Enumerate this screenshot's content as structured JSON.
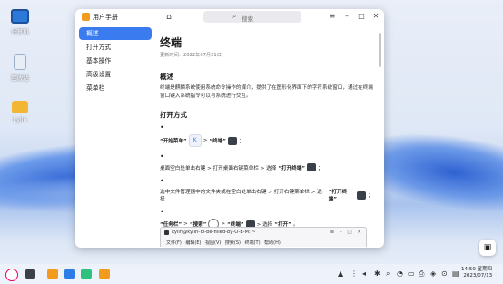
{
  "desktop": {
    "icons": [
      {
        "label": "计算机",
        "icon": "computer-icon"
      },
      {
        "label": "回收站",
        "icon": "trash-icon"
      },
      {
        "label": "kylin",
        "icon": "folder-icon"
      }
    ]
  },
  "window": {
    "app_title": "用户手册",
    "search_placeholder": "搜索",
    "controls": {
      "menu": "≡",
      "minimize": "–",
      "maximize": "□",
      "close": "✕"
    }
  },
  "sidebar": {
    "items": [
      {
        "label": "概述",
        "active": true
      },
      {
        "label": "打开方式",
        "active": false
      },
      {
        "label": "基本操作",
        "active": false
      },
      {
        "label": "高级设置",
        "active": false
      },
      {
        "label": "菜单栏",
        "active": false
      }
    ]
  },
  "doc": {
    "title": "终端",
    "date": "更新时间：2022年07月21日",
    "overview_heading": "概述",
    "overview_text": "终端是麒麟系统使用系统命令操作的媒介，提供了在图形化界面下的字符系统窗口，通过在终端窗口键入系统指令可以与系统进行交互。",
    "open_heading": "打开方式",
    "step1": {
      "a": "“开始菜单”",
      "sep1": " > ",
      "b": "“终端”",
      "tail": "；"
    },
    "step2": {
      "a": "桌面空白处单击右键 > 打开桌面右键菜单栏 > 选择",
      "b": "“打开终端”",
      "tail": "；"
    },
    "step3": {
      "a": "选中文件管理器中的文件夹或在空白处单击右键 > 打开右键菜单栏 > 选择",
      "b": "“打开终端”",
      "tail": "；"
    },
    "step4": {
      "a": "“任务栏”",
      "sep1": " > ",
      "b": "“搜索”",
      "sep2": " > ",
      "c": "“终端”",
      "tail": " > 选择",
      "d": "“打开”",
      "end": "。"
    },
    "terminal_preview": {
      "title": "kylin@kylin-To-be-filled-by-O-E-M: ~",
      "menu": "文件(F) 编辑(E) 视图(V) 搜索(S) 终端(T) 帮助(H)",
      "buttons": "≡ – □ ✕"
    }
  },
  "taskbar": {
    "clock_time": "14:50 星期四",
    "clock_date": "2023/07/13"
  },
  "colors": {
    "accent": "#3a7bf0",
    "logo": "#f29b1e"
  }
}
